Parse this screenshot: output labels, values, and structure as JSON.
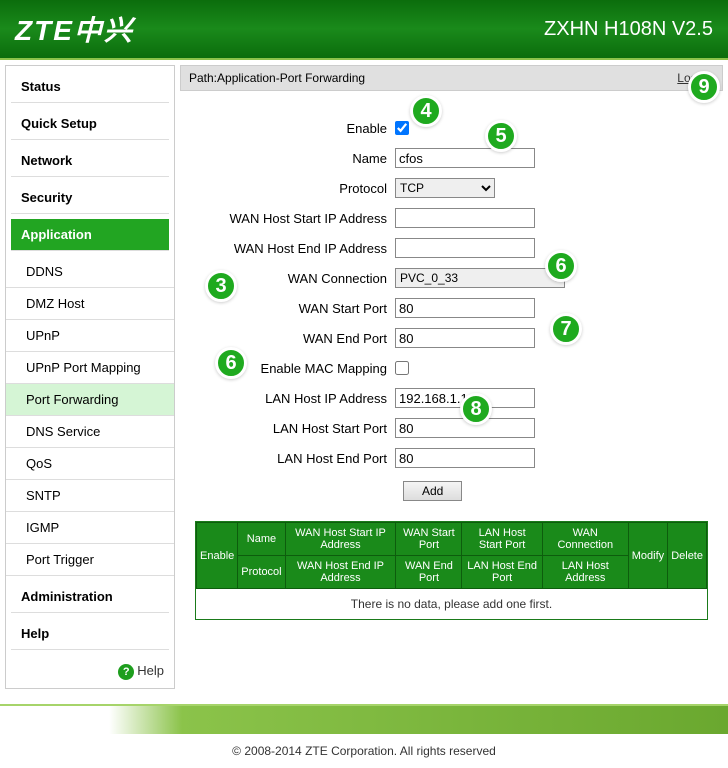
{
  "header": {
    "brand": "ZTE中兴",
    "model": "ZXHN H108N V2.5"
  },
  "sidebar": {
    "items": [
      {
        "label": "Status",
        "type": "main"
      },
      {
        "label": "Quick Setup",
        "type": "main"
      },
      {
        "label": "Network",
        "type": "main"
      },
      {
        "label": "Security",
        "type": "main"
      },
      {
        "label": "Application",
        "type": "main",
        "active": true
      },
      {
        "label": "DDNS",
        "type": "sub"
      },
      {
        "label": "DMZ Host",
        "type": "sub"
      },
      {
        "label": "UPnP",
        "type": "sub"
      },
      {
        "label": "UPnP Port Mapping",
        "type": "sub"
      },
      {
        "label": "Port Forwarding",
        "type": "sub",
        "selected": true
      },
      {
        "label": "DNS Service",
        "type": "sub"
      },
      {
        "label": "QoS",
        "type": "sub"
      },
      {
        "label": "SNTP",
        "type": "sub"
      },
      {
        "label": "IGMP",
        "type": "sub"
      },
      {
        "label": "Port Trigger",
        "type": "sub"
      },
      {
        "label": "Administration",
        "type": "main"
      },
      {
        "label": "Help",
        "type": "main"
      }
    ],
    "help_label": "Help"
  },
  "breadcrumb": {
    "path": "Path:Application-Port Forwarding",
    "logout": "Logout"
  },
  "form": {
    "enable_label": "Enable",
    "enable_value": true,
    "name_label": "Name",
    "name_value": "cfos",
    "protocol_label": "Protocol",
    "protocol_value": "TCP",
    "wan_host_start_ip_label": "WAN Host Start IP Address",
    "wan_host_start_ip_value": "",
    "wan_host_end_ip_label": "WAN Host End IP Address",
    "wan_host_end_ip_value": "",
    "wan_connection_label": "WAN Connection",
    "wan_connection_value": "PVC_0_33",
    "wan_start_port_label": "WAN Start Port",
    "wan_start_port_value": "80",
    "wan_end_port_label": "WAN End Port",
    "wan_end_port_value": "80",
    "enable_mac_label": "Enable MAC Mapping",
    "enable_mac_value": false,
    "lan_host_ip_label": "LAN Host IP Address",
    "lan_host_ip_value": "192.168.1.100",
    "lan_start_port_label": "LAN Host Start Port",
    "lan_start_port_value": "80",
    "lan_end_port_label": "LAN Host End Port",
    "lan_end_port_value": "80",
    "add_label": "Add"
  },
  "table": {
    "headers": {
      "enable": "Enable",
      "name": "Name",
      "protocol": "Protocol",
      "wan_host_start_ip": "WAN Host Start IP Address",
      "wan_host_end_ip": "WAN Host End IP Address",
      "wan_start_port": "WAN Start Port",
      "wan_end_port": "WAN End Port",
      "lan_host_start_port": "LAN Host Start Port",
      "lan_host_end_port": "LAN Host End Port",
      "wan_connection": "WAN Connection",
      "lan_host_address": "LAN Host Address",
      "modify": "Modify",
      "delete": "Delete"
    },
    "empty_message": "There is no data, please add one first."
  },
  "footer": {
    "copyright": "© 2008-2014 ZTE Corporation. All rights reserved"
  },
  "annotations": {
    "b3": "3",
    "b4": "4",
    "b5": "5",
    "b6a": "6",
    "b6b": "6",
    "b7": "7",
    "b8": "8",
    "b9": "9"
  }
}
